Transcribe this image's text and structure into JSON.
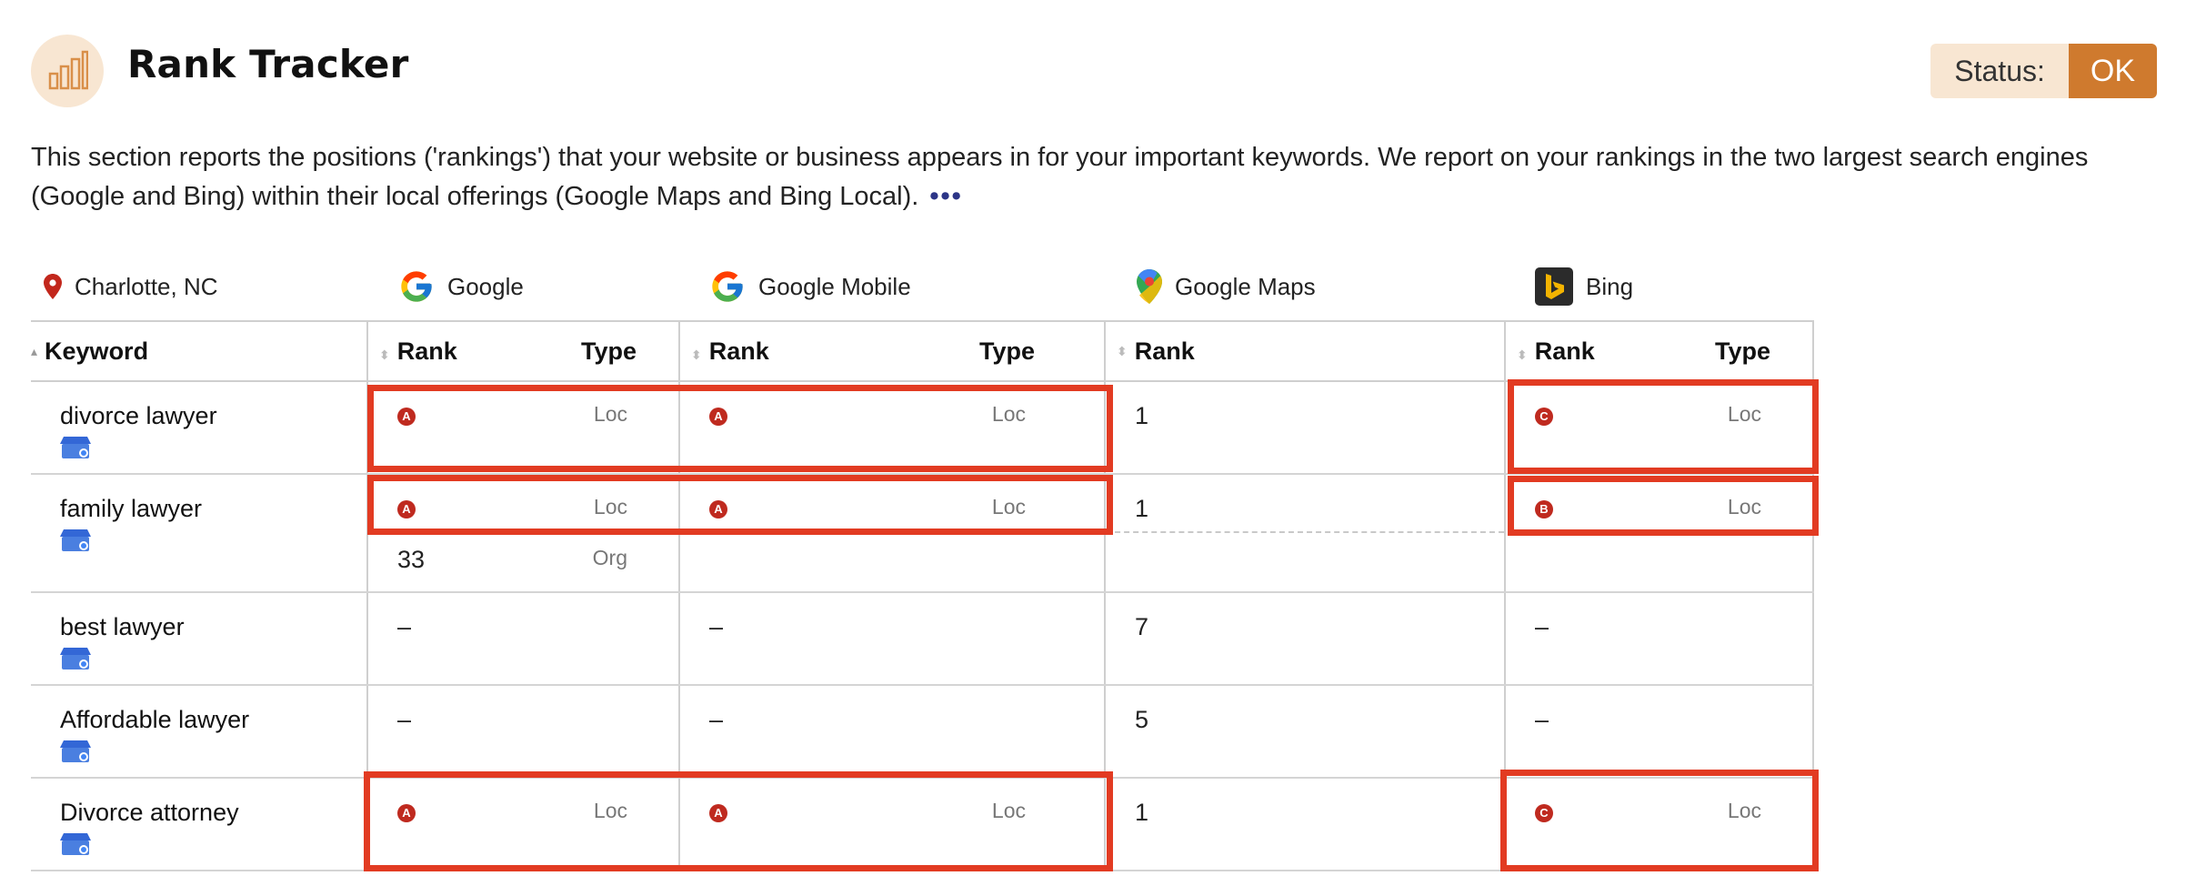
{
  "header": {
    "title": "Rank Tracker",
    "status_label": "Status:",
    "status_value": "OK",
    "status_color": "#cf7a2e"
  },
  "intro": {
    "text": "This section reports the positions ('rankings') that your website or business appears in for your important keywords. We report on your rankings in the two largest search engines (Google and Bing) within their local offerings (Google Maps and Bing Local).",
    "more": "•••"
  },
  "location": "Charlotte, NC",
  "engines": {
    "google": "Google",
    "google_mobile": "Google Mobile",
    "google_maps": "Google Maps",
    "bing": "Bing"
  },
  "columns": {
    "keyword": "Keyword",
    "rank": "Rank",
    "type": "Type"
  },
  "rows": [
    {
      "keyword": "divorce lawyer",
      "google": {
        "rank": "A",
        "type": "Loc"
      },
      "google_mobile": {
        "rank": "A",
        "type": "Loc"
      },
      "google_maps": {
        "rank": "1"
      },
      "bing": {
        "rank": "C",
        "type": "Loc"
      }
    },
    {
      "keyword": "family lawyer",
      "google": {
        "rank": "A",
        "type": "Loc"
      },
      "google_mobile": {
        "rank": "A",
        "type": "Loc"
      },
      "google_maps": {
        "rank": "1"
      },
      "bing": {
        "rank": "B",
        "type": "Loc"
      },
      "google_extra": {
        "rank": "33",
        "type": "Org"
      }
    },
    {
      "keyword": "best lawyer",
      "google": {
        "rank": "–"
      },
      "google_mobile": {
        "rank": "–"
      },
      "google_maps": {
        "rank": "7"
      },
      "bing": {
        "rank": "–"
      }
    },
    {
      "keyword": "Affordable lawyer",
      "google": {
        "rank": "–"
      },
      "google_mobile": {
        "rank": "–"
      },
      "google_maps": {
        "rank": "5"
      },
      "bing": {
        "rank": "–"
      }
    },
    {
      "keyword": "Divorce attorney",
      "google": {
        "rank": "A",
        "type": "Loc"
      },
      "google_mobile": {
        "rank": "A",
        "type": "Loc"
      },
      "google_maps": {
        "rank": "1"
      },
      "bing": {
        "rank": "C",
        "type": "Loc"
      }
    }
  ],
  "icons": {
    "header": "bar-chart-icon",
    "location": "location-pin-icon",
    "google": "google-g-icon",
    "google_maps": "google-maps-pin-icon",
    "bing": "bing-icon",
    "business": "google-my-business-icon"
  },
  "colors": {
    "badge": "#bf2a1f",
    "highlight": "#e23b22",
    "accent": "#cf7a2e"
  }
}
